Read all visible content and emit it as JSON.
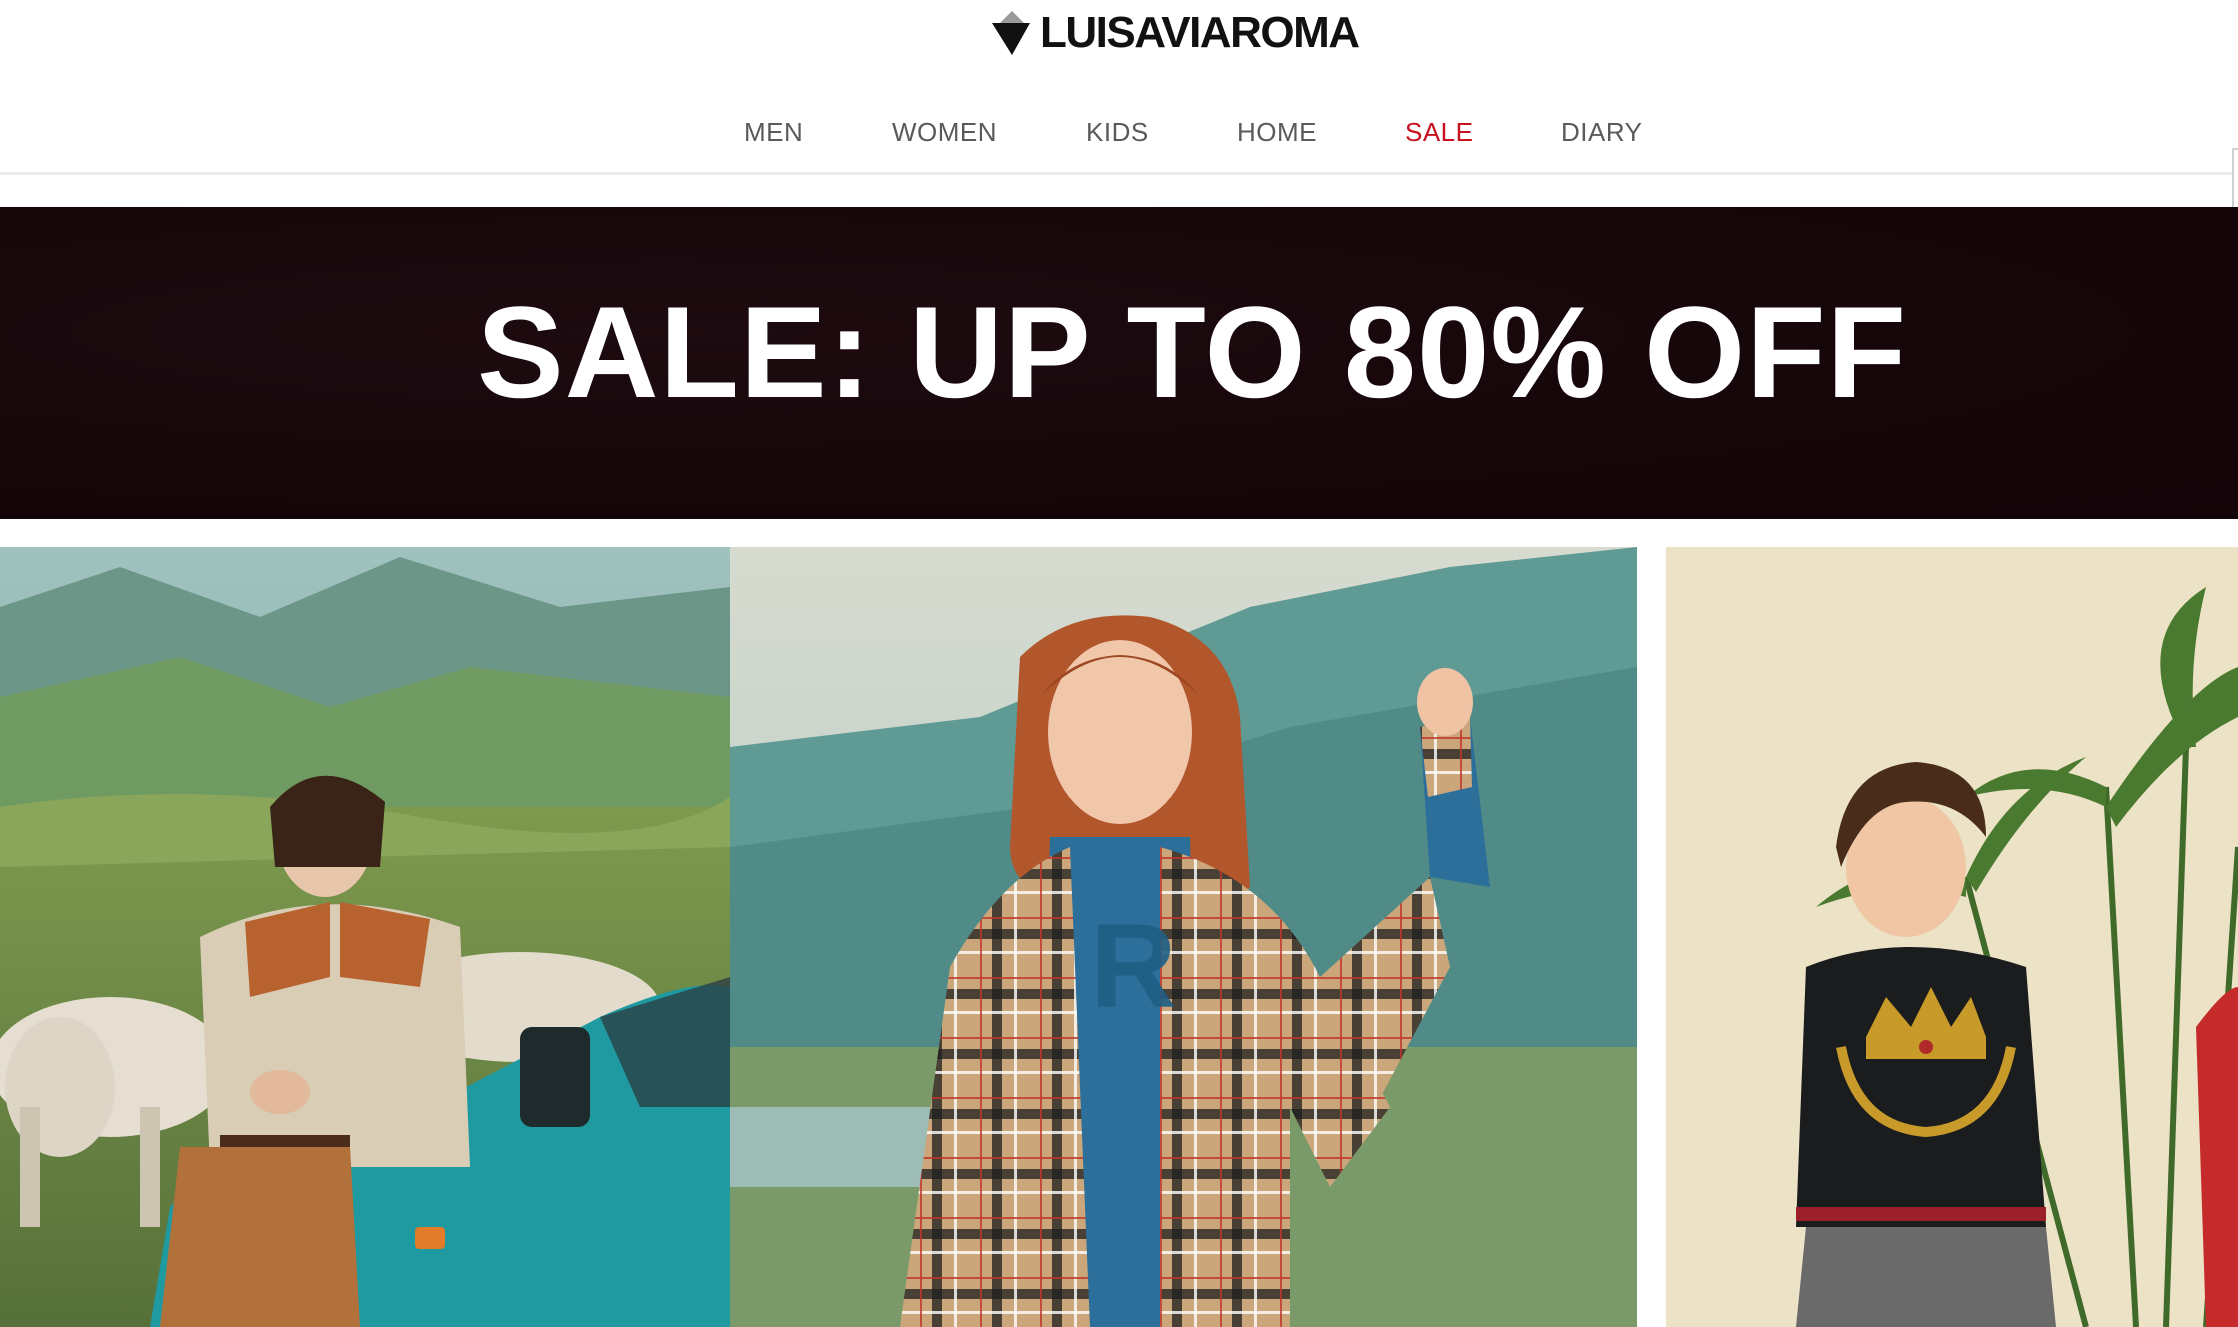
{
  "header": {
    "logo_text": "LUISAVIAROMA",
    "logo_icon": "triangle-logo-icon"
  },
  "nav": {
    "items": [
      {
        "label": "MEN"
      },
      {
        "label": "WOMEN"
      },
      {
        "label": "KIDS"
      },
      {
        "label": "HOME"
      },
      {
        "label": "SALE"
      },
      {
        "label": "DIARY"
      }
    ],
    "sale_color": "#c8101e"
  },
  "banner": {
    "title": "SALE: UP TO 80% OFF",
    "background": "#150609"
  },
  "tiles": [
    {
      "name": "men",
      "image": "men-campaign-photo"
    },
    {
      "name": "women",
      "image": "women-campaign-photo"
    },
    {
      "name": "kids",
      "image": "kids-campaign-photo"
    }
  ]
}
